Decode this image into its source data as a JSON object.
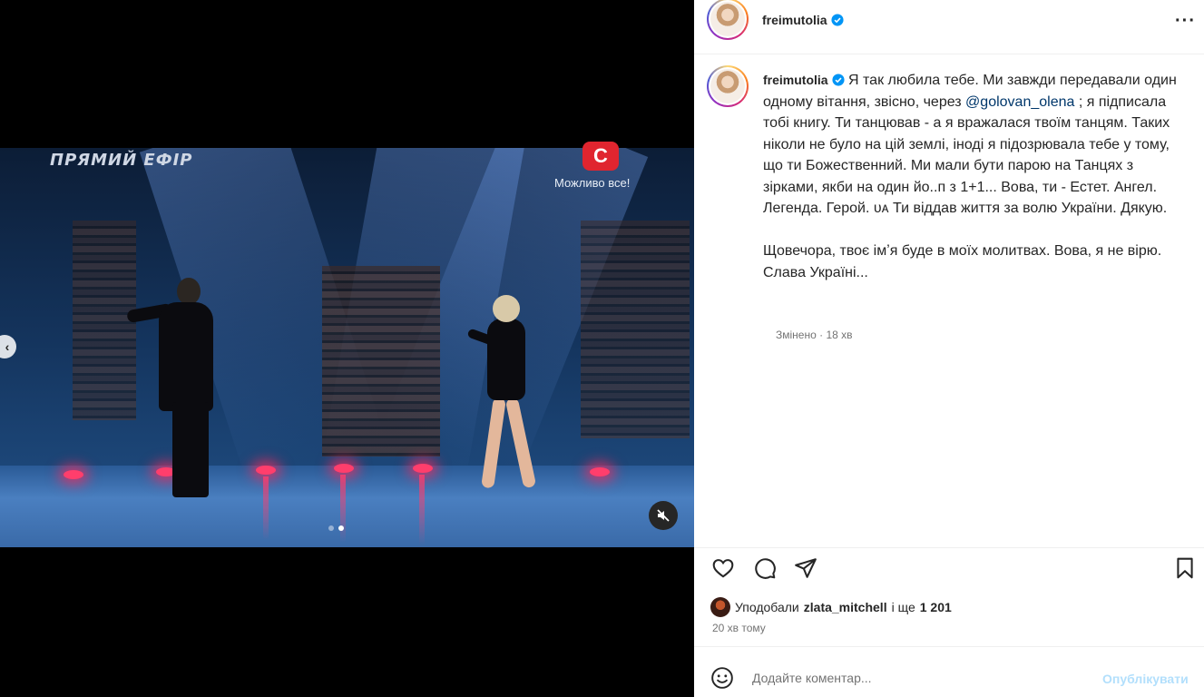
{
  "video": {
    "live_label": "ПРЯМИЙ ЕФІР",
    "channel_logo_text": "С",
    "channel_slogan": "Можливо все!",
    "slide_count": 2,
    "active_slide": 2,
    "muted": true
  },
  "post": {
    "username": "freimutolia",
    "verified": true,
    "caption": {
      "username": "freimutolia",
      "text_before_mention": " Я так любила тебе. Ми завжди передавали один одному вітання, звісно, через ",
      "mention": "@golovan_olena",
      "text_after_mention": " ; я підписала тобі книгу. Ти танцював - а я вражалася твоїм танцям. Таких ніколи не було на цій землі, іноді я підозрювала тебе у тому, що ти Божественний. Ми мали бути парою на Танцях з зірками, якби на один йо..п з 1+1... Вова, ти - Естет. Ангел. Легенда. Герой. ᴜᴀ Ти віддав життя за волю України. Дякую.",
      "text_paragraph_2": "Щовечора, твоє імʼя буде в моїх молитвах. Вова, я не вірю. Слава Україні...",
      "edited_label": "Змінено",
      "edited_time": "18 хв"
    },
    "likes": {
      "prefix": "Уподобали",
      "user": "zlata_mitchell",
      "middle": "і ще",
      "count": "1 201"
    },
    "time_ago": "20 хв тому"
  },
  "comment_box": {
    "placeholder": "Додайте коментар...",
    "publish_label": "Опублікувати"
  },
  "colors": {
    "text": "#262626",
    "secondary_text": "#737373",
    "mention": "#00376b",
    "verified_badge": "#0095f6",
    "publish_disabled": "#b2dffc"
  }
}
